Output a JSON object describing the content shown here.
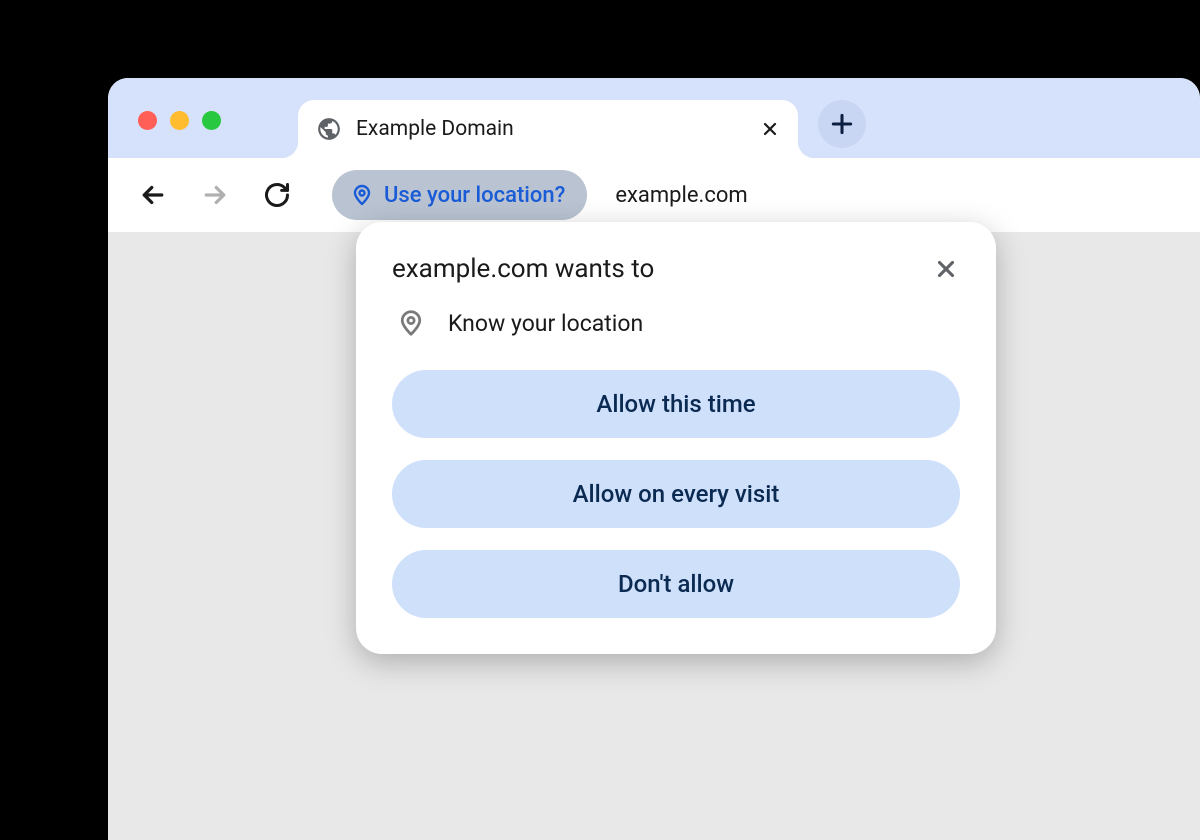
{
  "tab": {
    "title": "Example Domain"
  },
  "address": {
    "permission_chip": "Use your location?",
    "url": "example.com"
  },
  "dialog": {
    "title": "example.com wants to",
    "request_text": "Know your location",
    "buttons": {
      "allow_once": "Allow this time",
      "allow_always": "Allow on every visit",
      "deny": "Don't allow"
    }
  }
}
